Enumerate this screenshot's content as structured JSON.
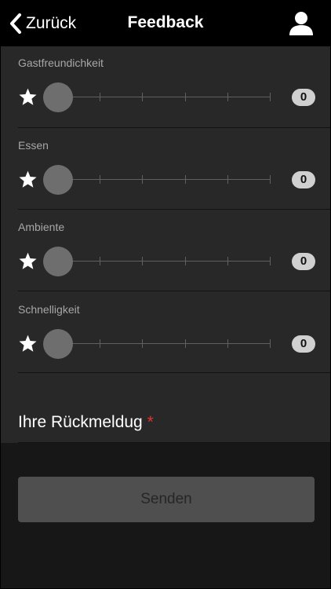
{
  "header": {
    "back_label": "Zurück",
    "title": "Feedback"
  },
  "ratings": [
    {
      "label": "Gastfreundichkeit",
      "value": "0"
    },
    {
      "label": "Essen",
      "value": "0"
    },
    {
      "label": "Ambiente",
      "value": "0"
    },
    {
      "label": "Schnelligkeit",
      "value": "0"
    }
  ],
  "feedback": {
    "label": "Ihre Rückmeldug",
    "required_marker": "*"
  },
  "send_label": "Senden",
  "icons": {
    "back": "chevron-left-icon",
    "user": "user-icon",
    "star": "star-icon"
  },
  "colors": {
    "header_bg": "#000000",
    "content_bg": "#282828",
    "page_bg": "#171717",
    "required": "#e0342f",
    "button_bg": "#4f4f4f"
  }
}
